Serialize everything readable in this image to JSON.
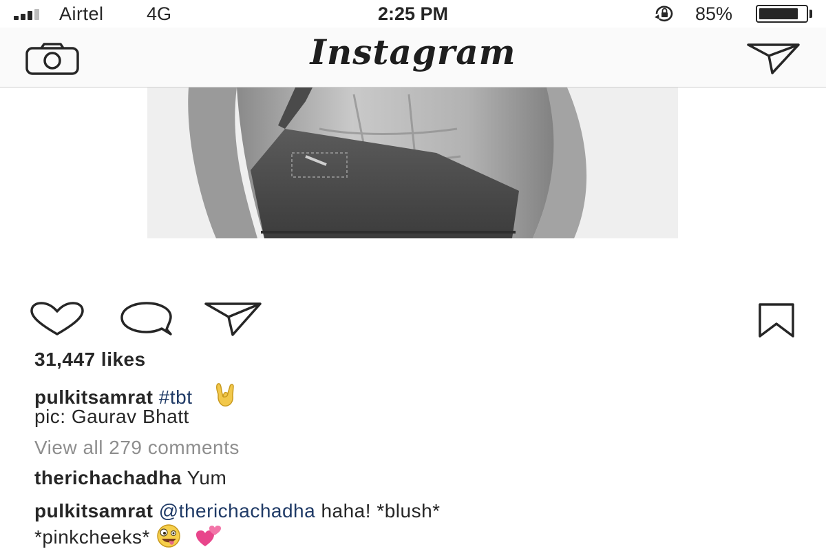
{
  "status_bar": {
    "carrier": "Airtel",
    "network": "4G",
    "time": "2:25 PM",
    "battery_percent": "85%",
    "battery_level": 0.85,
    "lock_icon": "orientation-lock-icon"
  },
  "nav": {
    "logo": "Instagram",
    "left_icon": "camera-icon",
    "right_icon": "direct-message-icon"
  },
  "post": {
    "likes": "31,447 likes",
    "caption": {
      "username": "pulkitsamrat",
      "hashtag": "#tbt",
      "emoji": "rock-on-hand-emoji",
      "line2": "pic: Gaurav Bhatt"
    },
    "view_comments": "View all 279 comments",
    "comments": [
      {
        "username": "therichachadha",
        "text": "Yum"
      },
      {
        "username": "pulkitsamrat",
        "mention": "@therichachadha",
        "text": "haha! *blush*",
        "line2": "*pinkcheeks*",
        "emojis": [
          "zany-face-emoji",
          "two-hearts-emoji"
        ]
      }
    ],
    "action_icons": [
      "heart-icon",
      "comment-icon",
      "share-icon",
      "bookmark-icon"
    ]
  }
}
